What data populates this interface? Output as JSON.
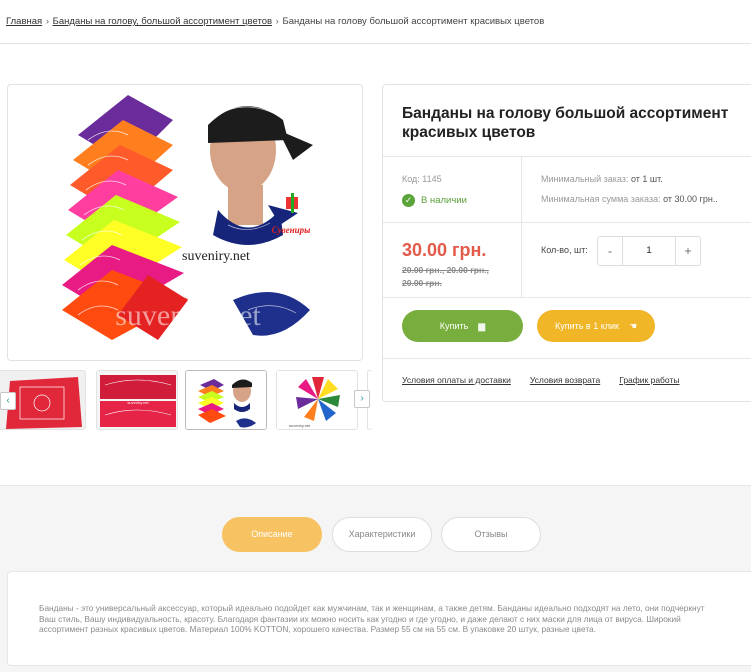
{
  "breadcrumb": {
    "home": "Главная",
    "category": "Банданы на голову, большой ассортимент цветов",
    "current": "Банданы на голову большой ассортимент красивых цветов",
    "separator": "›"
  },
  "product": {
    "title": "Банданы на голову большой ассортимент красивых цветов",
    "code": "Код: 1145",
    "stock": "В наличии",
    "min_order_label": "Минимальный заказ:",
    "min_order_value": "от 1 шт.",
    "min_sum_label": "Минимальная сумма заказа:",
    "min_sum_value": "от 30.00 грн..",
    "price": "30.00 грн.",
    "old_prices": "20.00 грн., 20.00 грн., 20.00 грн.",
    "qty_label": "Кол-во, шт:",
    "qty_value": "1",
    "qty_minus": "-",
    "qty_plus": "+",
    "buy_label": "Купить",
    "buy_one_click_label": "Купить в 1 клик",
    "photo_watermark": "suveniry.net",
    "photo_caption": "suveniry.net",
    "photo_logo": "Сувениры",
    "thumb_text_2": "suveniry.net",
    "thumb_text_4": "suveniry.net"
  },
  "links": {
    "payment": "Условия оплаты и доставки",
    "returns": "Условия возврата",
    "schedule": "График работы"
  },
  "gallery": {
    "prev": "‹",
    "next": "›"
  },
  "tabs": {
    "description": "Описание",
    "specs": "Характеристики",
    "reviews": "Отзывы"
  },
  "description": "Банданы - это универсальный аксессуар, который идеально подойдет как мужчинам, так и женщинам, а также детям. Банданы идеально подходят на лето, они подчеркнут Ваш стиль, Вашу индивидуальность, красоту. Благодаря фантазии их можно носить как угодно и где угодно, и даже делают с них маски для лица от вируса. Широкий ассортимент разных красивых цветов. Материал 100% KOTTON, хорошего качества. Размер 55 см на 55 см. В упаковке 20 штук, разные цвета.",
  "colors": {
    "accent_green": "#78ae3d",
    "accent_yellow": "#f0b627",
    "price_red": "#e35a4a",
    "tab_active": "#f7c262"
  }
}
